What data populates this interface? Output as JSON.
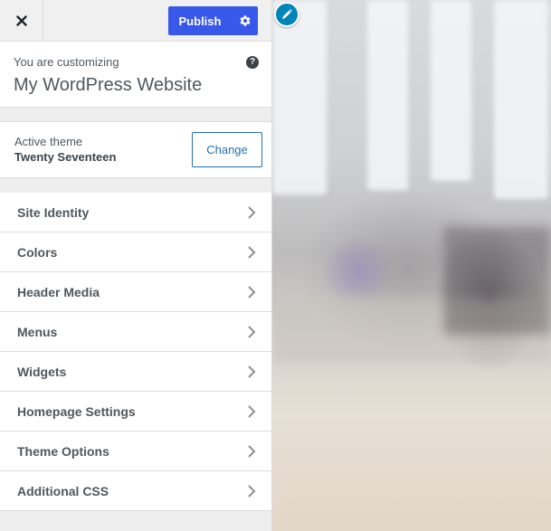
{
  "header": {
    "close_label": "×",
    "publish_label": "Publish"
  },
  "info": {
    "pre_title": "You are customizing",
    "site_title": "My WordPress Website"
  },
  "theme": {
    "label": "Active theme",
    "name": "Twenty Seventeen",
    "change_label": "Change"
  },
  "menu": {
    "items": [
      {
        "label": "Site Identity"
      },
      {
        "label": "Colors"
      },
      {
        "label": "Header Media"
      },
      {
        "label": "Menus"
      },
      {
        "label": "Widgets"
      },
      {
        "label": "Homepage Settings"
      },
      {
        "label": "Theme Options"
      },
      {
        "label": "Additional CSS"
      }
    ]
  },
  "colors": {
    "accent": "#3858e9",
    "link": "#2271b1",
    "edit_shortcut": "#0085ba"
  },
  "icons": {
    "close": "close-icon",
    "settings": "gear-icon",
    "help": "help-icon",
    "chevron": "chevron-right-icon",
    "edit": "pencil-icon"
  }
}
